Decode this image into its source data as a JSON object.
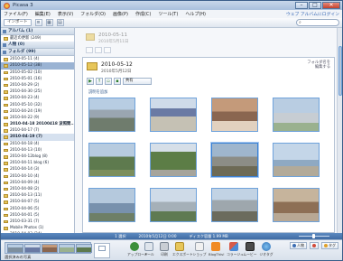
{
  "window": {
    "title": "Picasa 3"
  },
  "menu": {
    "items": [
      "ファイル(F)",
      "編集(E)",
      "表示(V)",
      "フォルダ(O)",
      "画像(P)",
      "作成(C)",
      "ツール(T)",
      "ヘルプ(H)"
    ],
    "right_links": "ウェブ アルバムにログイン"
  },
  "toolbar": {
    "import_label": "インポート",
    "search_placeholder": ""
  },
  "left": {
    "groups": [
      {
        "label": "アルバム (1)"
      },
      {
        "label": "人物 (0)"
      },
      {
        "label": "フォルダ (99)"
      }
    ],
    "album_item": "最近の更新 (249)",
    "folders": [
      "2010-05-11 (4)",
      "2010-05-12 (38)",
      "2010-05-02 (10)",
      "2010-05-01 (16)",
      "2010-04-29 (2)",
      "2010-04-30 (25)",
      "2010-04-23 (4)",
      "2010-05-10 (32)",
      "2010-04-24 (19)",
      "2010-04-22 (9)",
      "2010-04-18 20100418 波照間...",
      "2010-04-17 (7)",
      "2010-04-19 (7)",
      "2010-04-18 (4)",
      "2010-04-13 (10)",
      "2010-04-12blog (8)",
      "2010-04-11 blog (6)",
      "2010-04-14 (3)",
      "2010-04-10 (4)",
      "2010-04-09 (4)",
      "2010-04-08 (2)",
      "2010-04-13 (11)",
      "2010-04-07 (5)",
      "2010-04-06 (5)",
      "2010-04-01 (5)",
      "2010-03-31 (7)",
      "Mobile Photos (1)",
      "2010-04-03 (24)",
      "2010-03-29 (4)"
    ]
  },
  "main": {
    "prev_album": {
      "date": "2010-05-11",
      "sub": "2010年5月11日"
    },
    "album": {
      "date": "2010-05-12",
      "sub": "2010年5月12日",
      "right_line1": "フォルダ名を",
      "right_line2": "編集する",
      "share_label": "共有",
      "caption": "説明を追加"
    }
  },
  "status": {
    "left": "1 選択",
    "mid": "2010年5月12日 0:00",
    "right": "ディスク容量 1.99 MB"
  },
  "tray": {
    "label": "選択済みの写真",
    "actions": [
      {
        "label": "アップロード"
      },
      {
        "label": "メール"
      },
      {
        "label": "印刷"
      },
      {
        "label": "エクスポート"
      },
      {
        "label": "ショップ"
      },
      {
        "label": "BlogThis!"
      },
      {
        "label": "コラージュ"
      },
      {
        "label": "ムービー"
      },
      {
        "label": "ジオタグ"
      }
    ],
    "right": {
      "people": "人物",
      "places": "地図",
      "tags": "タグ"
    }
  },
  "colors": {
    "accent": "#3b82d6",
    "statusbar": "#4e7bb3",
    "folder": "#e7c65a"
  }
}
